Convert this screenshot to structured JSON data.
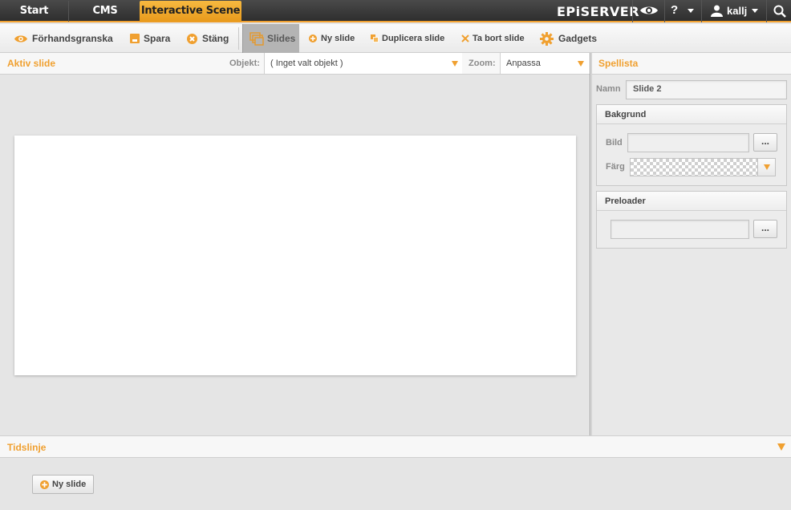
{
  "topnav": {
    "tabs": [
      "Start",
      "CMS",
      "Interactive Scene"
    ],
    "logo": "EPiSERVER",
    "help": "?",
    "user": "kallj",
    "icons": [
      "eye-icon",
      "help-icon",
      "user-icon",
      "search-icon"
    ]
  },
  "toolbar": {
    "preview": "Förhandsgranska",
    "save": "Spara",
    "close": "Stäng",
    "slides": "Slides",
    "new_slide": "Ny slide",
    "duplicate_slide": "Duplicera slide",
    "delete_slide": "Ta bort slide",
    "gadgets": "Gadgets"
  },
  "active_slide": {
    "title": "Aktiv slide",
    "object_label": "Objekt:",
    "object_value": "( Inget valt objekt )",
    "zoom_label": "Zoom:",
    "zoom_value": "Anpassa"
  },
  "playlist": {
    "title": "Spellista",
    "name_label": "Namn",
    "name_value": "Slide 2",
    "background": {
      "title": "Bakgrund",
      "image_label": "Bild",
      "color_label": "Färg",
      "browse": "..."
    },
    "preloader": {
      "title": "Preloader",
      "browse": "..."
    }
  },
  "timeline": {
    "title": "Tidslinje",
    "new_slide": "Ny slide"
  },
  "colors": {
    "accent": "#f0a030",
    "topbar": "#333333",
    "panel": "#e5e5e5"
  }
}
